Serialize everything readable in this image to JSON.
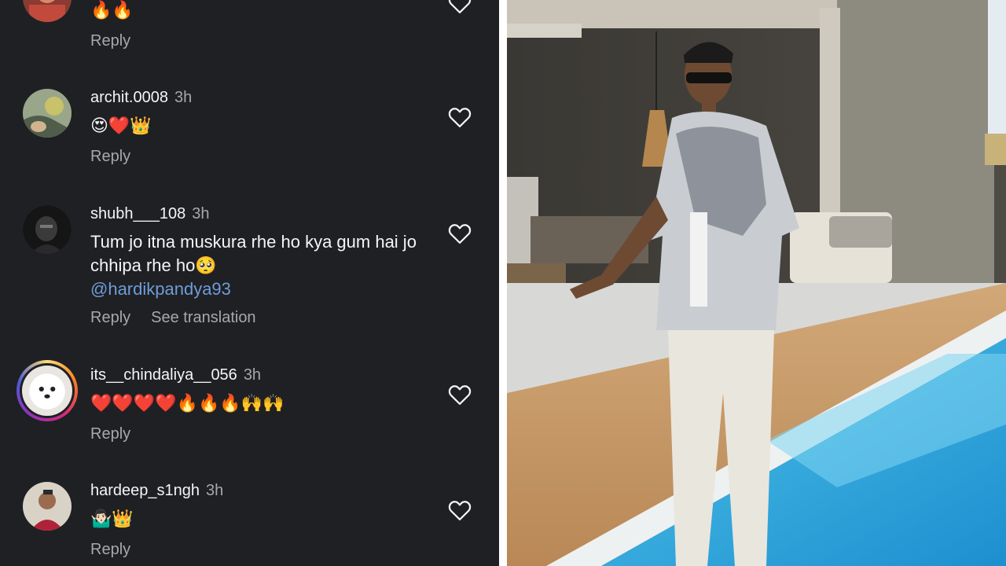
{
  "comments": [
    {
      "username": "",
      "time": "",
      "text": "🔥🔥",
      "reply_label": "Reply"
    },
    {
      "username": "archit.0008",
      "time": "3h",
      "text": "😍❤️👑",
      "reply_label": "Reply"
    },
    {
      "username": "shubh___108",
      "time": "3h",
      "text": "Tum jo itna muskura rhe ho kya gum hai jo chhipa rhe ho🥺",
      "mention": "@hardikpandya93",
      "reply_label": "Reply",
      "translate_label": "See translation"
    },
    {
      "username": "its__chindaliya__056",
      "time": "3h",
      "text": "❤️❤️❤️❤️🔥🔥🔥🙌🙌",
      "reply_label": "Reply"
    },
    {
      "username": "hardeep_s1ngh",
      "time": "3h",
      "text": "🤷🏻‍♂️👑",
      "reply_label": "Reply"
    }
  ],
  "colors": {
    "panel_bg": "#1f2024",
    "text": "#f5f5f5",
    "muted": "#a8a8a8",
    "mention": "#6f9cd8"
  },
  "icons": {
    "like": "heart-outline-icon",
    "avatar": "profile-avatar"
  }
}
